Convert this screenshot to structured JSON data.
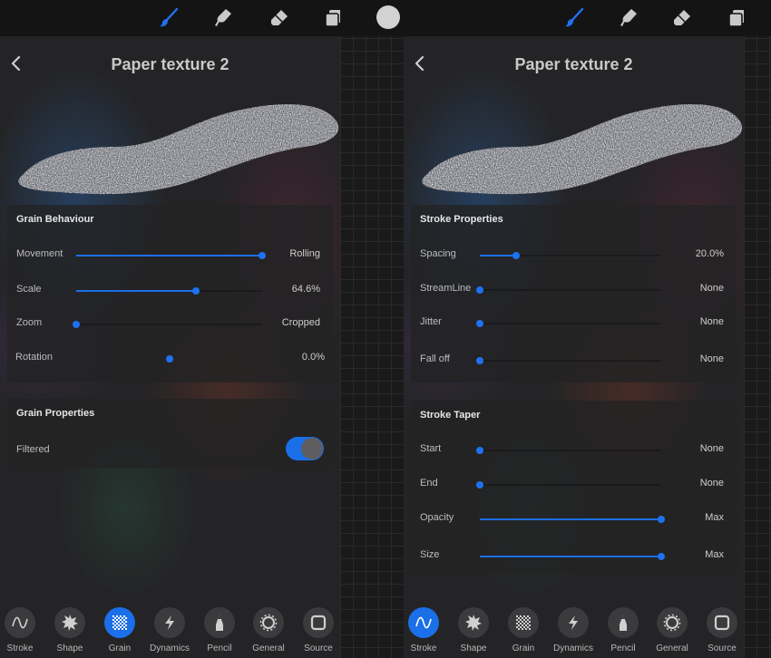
{
  "left": {
    "title": "Paper texture 2",
    "section1": {
      "title": "Grain Behaviour",
      "rows": [
        {
          "label": "Movement",
          "value": "Rolling",
          "level": 1.0
        },
        {
          "label": "Scale",
          "value": "64.6%",
          "level": 0.646
        },
        {
          "label": "Zoom",
          "value": "Cropped",
          "level": 0.0
        },
        {
          "label": "Rotation",
          "value": "0.0%",
          "level": 0.5
        }
      ]
    },
    "section2": {
      "title": "Grain Properties",
      "toggle_label": "Filtered",
      "toggle_on": true
    },
    "active_tab": "Grain"
  },
  "right": {
    "title": "Paper texture 2",
    "section1": {
      "title": "Stroke Properties",
      "rows": [
        {
          "label": "Spacing",
          "value": "20.0%",
          "level": 0.2
        },
        {
          "label": "StreamLine",
          "value": "None",
          "level": 0.0
        },
        {
          "label": "Jitter",
          "value": "None",
          "level": 0.0
        },
        {
          "label": "Fall off",
          "value": "None",
          "level": 0.0
        }
      ]
    },
    "section2": {
      "title": "Stroke Taper",
      "rows": [
        {
          "label": "Start",
          "value": "None",
          "level": 0.0
        },
        {
          "label": "End",
          "value": "None",
          "level": 0.0
        },
        {
          "label": "Opacity",
          "value": "Max",
          "level": 1.0
        },
        {
          "label": "Size",
          "value": "Max",
          "level": 1.0
        }
      ]
    },
    "active_tab": "Stroke"
  },
  "tabs": [
    {
      "label": "Stroke",
      "icon": "wave-icon"
    },
    {
      "label": "Shape",
      "icon": "starburst-icon"
    },
    {
      "label": "Grain",
      "icon": "checker-icon"
    },
    {
      "label": "Dynamics",
      "icon": "lightning-icon"
    },
    {
      "label": "Pencil",
      "icon": "pencil-tip-icon"
    },
    {
      "label": "General",
      "icon": "gear-icon"
    },
    {
      "label": "Source",
      "icon": "square-icon"
    }
  ],
  "toolbar": [
    "brush-icon",
    "smudge-icon",
    "eraser-icon",
    "layers-icon",
    "color-icon"
  ],
  "colors": {
    "accent": "#1b6fe8",
    "panel": "#242426",
    "topbar": "#141415"
  }
}
